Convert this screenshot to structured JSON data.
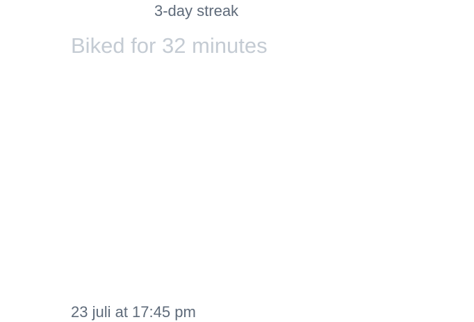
{
  "post": {
    "streak_label": "3-day streak",
    "activity_text": "Biked for 32 minutes",
    "timestamp": "23 juli at 17:45 pm"
  },
  "colors": {
    "primary_text": "#5f6b7a",
    "muted_text": "#c4cbd3",
    "background": "#ffffff"
  }
}
